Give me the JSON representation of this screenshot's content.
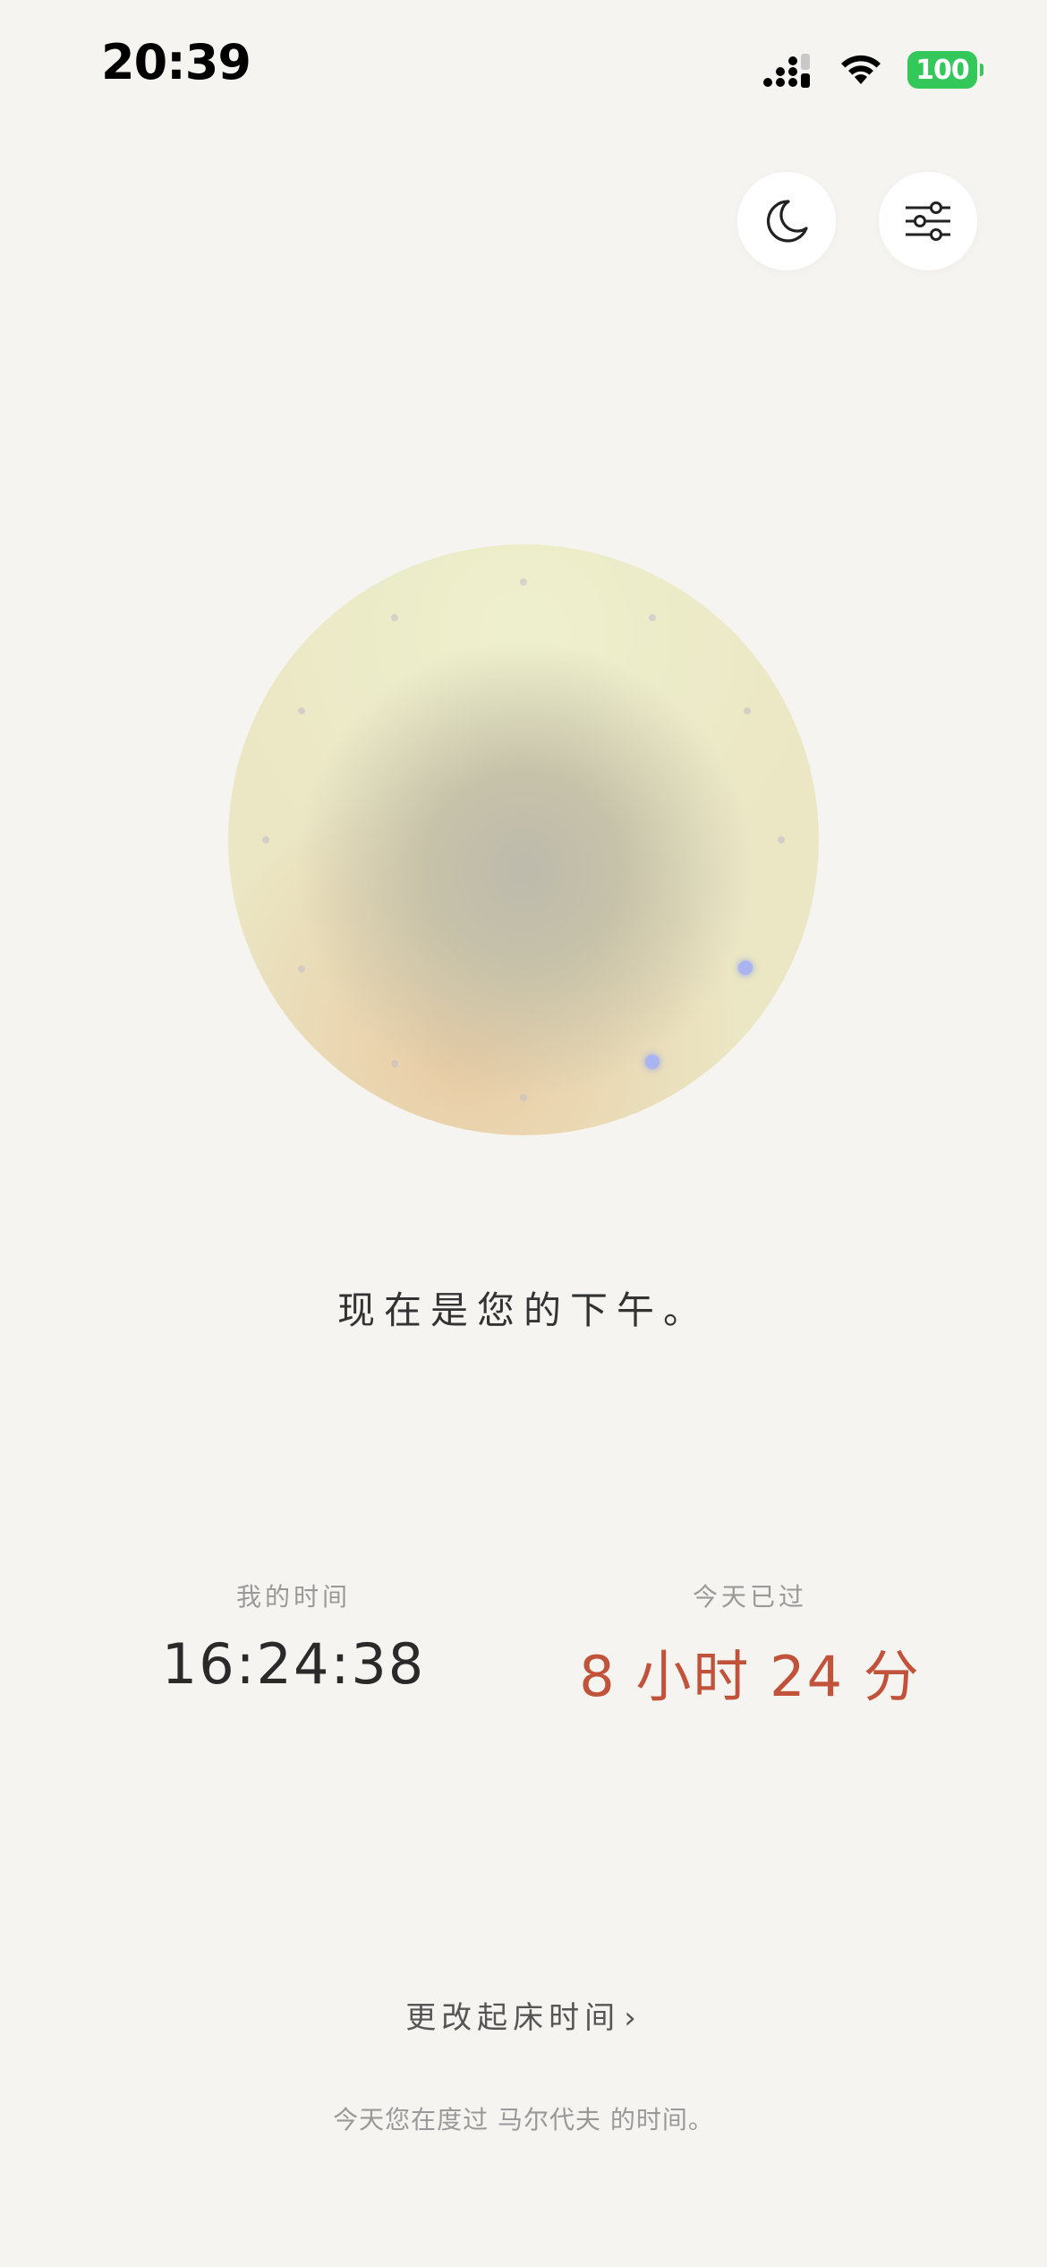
{
  "status_bar": {
    "time": "20:39",
    "battery": "100",
    "icons": [
      "signal-icon",
      "wifi-icon",
      "battery-icon"
    ]
  },
  "header": {
    "buttons": [
      "moon-icon",
      "sliders-icon"
    ]
  },
  "main": {
    "greeting": "现在是您的下午。"
  },
  "stats": {
    "my_time_label": "我的时间",
    "my_time_value": "16:24:38",
    "elapsed_label": "今天已过",
    "elapsed_value": "8 小时 24 分"
  },
  "footer": {
    "change_wake_label": "更改起床时间",
    "chevron": "›",
    "note": "今天您在度过 马尔代夫 的时间。"
  },
  "colors": {
    "background": "#f6f4f1",
    "accent": "#c0533a",
    "battery": "#34c759",
    "orb_dot_active": "#a9b4f0"
  }
}
